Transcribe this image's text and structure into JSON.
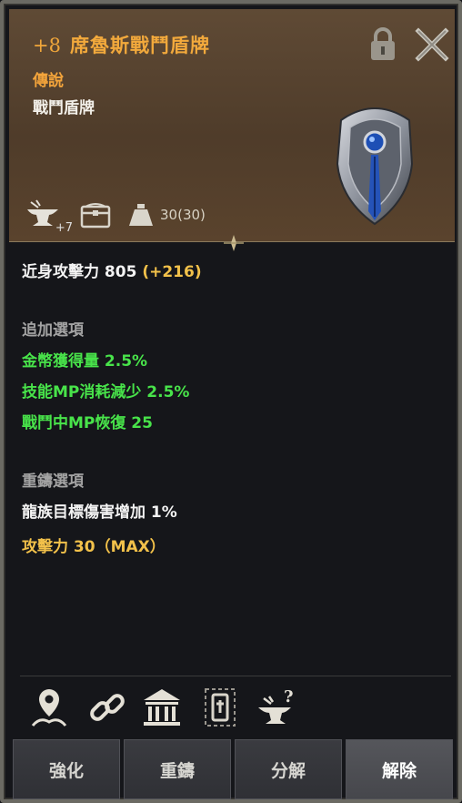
{
  "header": {
    "enhance_level": "+8",
    "item_name": "席魯斯戰鬥盾牌",
    "rarity": "傳說",
    "item_type": "戰鬥盾牌",
    "anvil_bonus": "+7",
    "weight": "30(30)"
  },
  "stats": {
    "base_label": "近身攻擊力 805",
    "base_bonus": "(+216)"
  },
  "additional": {
    "title": "追加選項",
    "lines": [
      "金幣獲得量 2.5%",
      "技能MP消耗減少 2.5%",
      "戰鬥中MP恢復 25"
    ]
  },
  "reforge": {
    "title": "重鑄選項",
    "line1": "龍族目標傷害增加 1%",
    "line2": "攻擊力 30（MAX）"
  },
  "tools": [
    "location-pin-icon",
    "link-icon",
    "museum-icon",
    "lock-frame-icon",
    "anvil-question-icon"
  ],
  "buttons": [
    "強化",
    "重鑄",
    "分解",
    "解除"
  ],
  "colors": {
    "gold": "#f2c14a",
    "green": "#48e34a",
    "title": "#f2a93c"
  }
}
